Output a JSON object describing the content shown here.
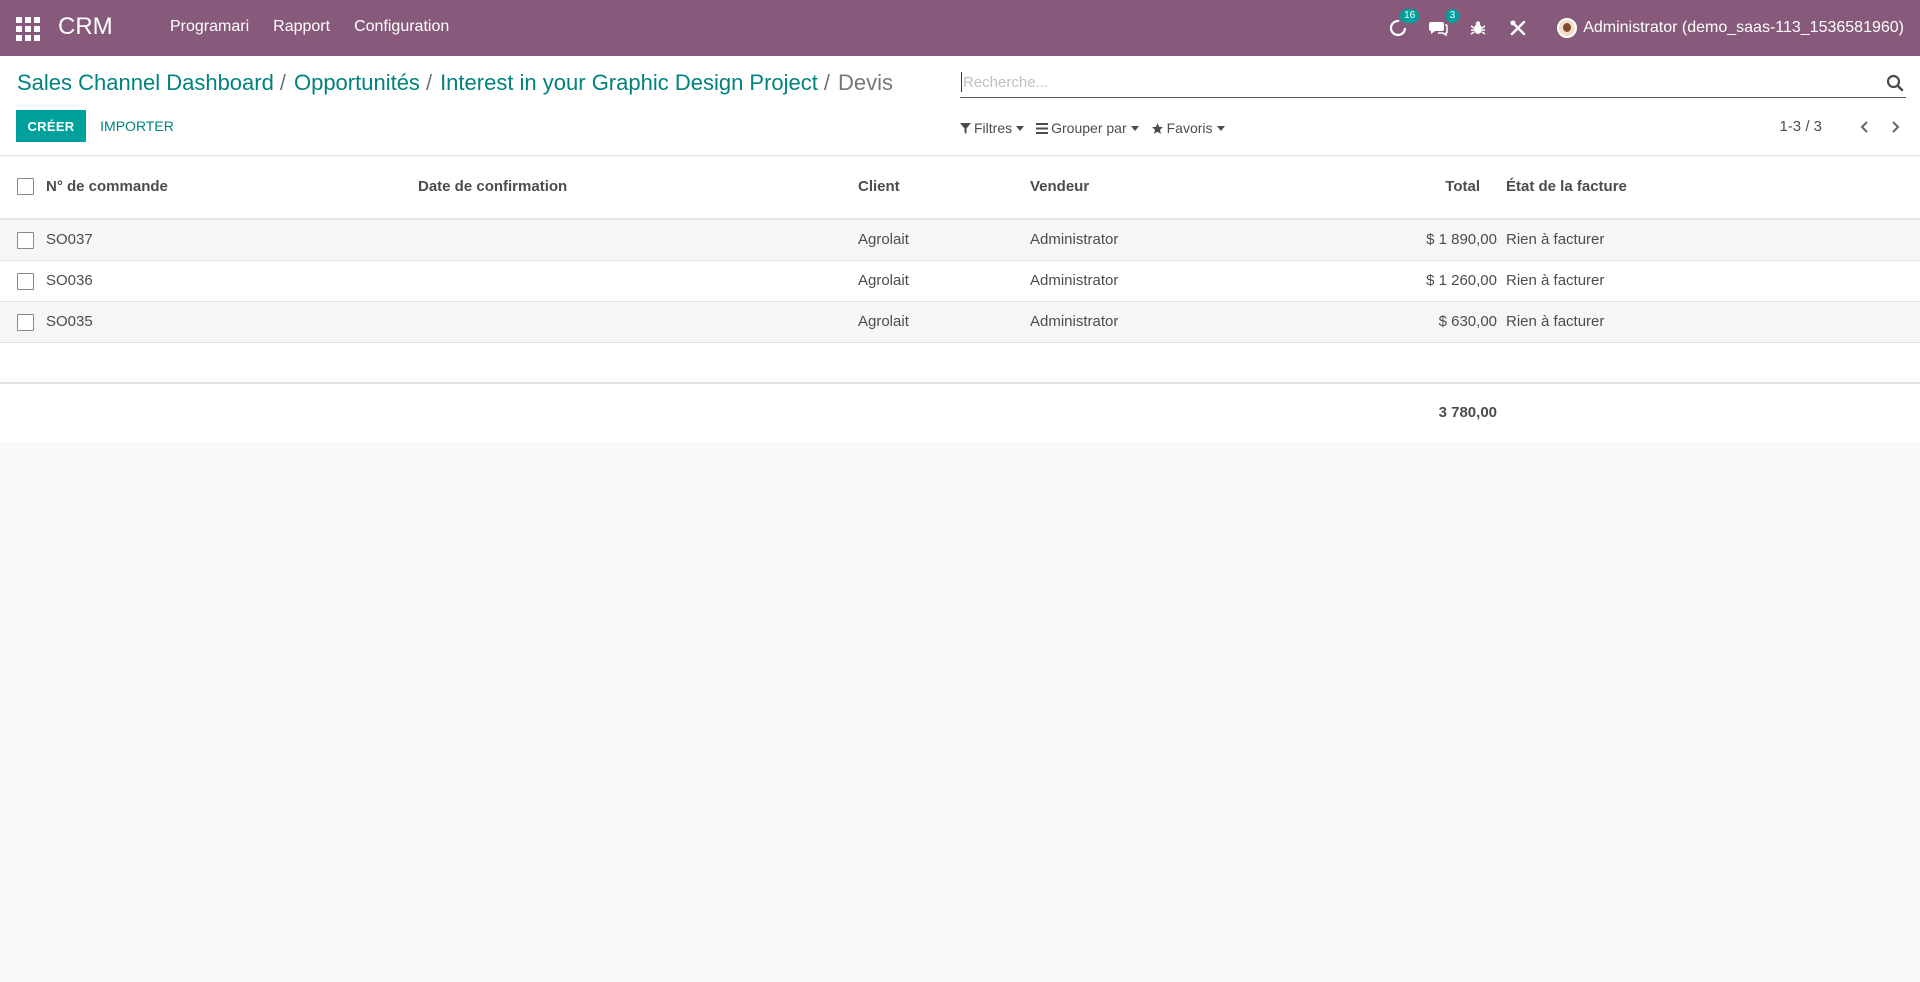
{
  "navbar": {
    "app_name": "CRM",
    "menu": [
      {
        "label": "Programari"
      },
      {
        "label": "Rapport"
      },
      {
        "label": "Configuration"
      }
    ],
    "activity_count": "16",
    "messages_count": "3",
    "user_name": "Administrator (demo_saas-113_1536581960)",
    "bg_color": "#875a7b"
  },
  "breadcrumb": {
    "items": [
      {
        "label": "Sales Channel Dashboard"
      },
      {
        "label": "Opportunités"
      },
      {
        "label": "Interest in your Graphic Design Project"
      }
    ],
    "separator": "/",
    "current": "Devis"
  },
  "search": {
    "placeholder": "Recherche..."
  },
  "buttons": {
    "create": "CRÉER",
    "import": "IMPORTER"
  },
  "search_options": {
    "filters": "Filtres",
    "group_by": "Grouper par",
    "favorites": "Favoris"
  },
  "pager": {
    "value": "1-3 / 3"
  },
  "table": {
    "columns": {
      "order": "N° de commande",
      "date": "Date de confirmation",
      "client": "Client",
      "vendor": "Vendeur",
      "total": "Total",
      "invoice_state": "État de la facture"
    },
    "rows": [
      {
        "order": "SO037",
        "date": "",
        "client": "Agrolait",
        "vendor": "Administrator",
        "total": "$ 1 890,00",
        "invoice_state": "Rien à facturer"
      },
      {
        "order": "SO036",
        "date": "",
        "client": "Agrolait",
        "vendor": "Administrator",
        "total": "$ 1 260,00",
        "invoice_state": "Rien à facturer"
      },
      {
        "order": "SO035",
        "date": "",
        "client": "Agrolait",
        "vendor": "Administrator",
        "total": "$ 630,00",
        "invoice_state": "Rien à facturer"
      }
    ],
    "footer_total": "3 780,00"
  },
  "colors": {
    "accent": "#00a09d",
    "link": "#00827f"
  }
}
